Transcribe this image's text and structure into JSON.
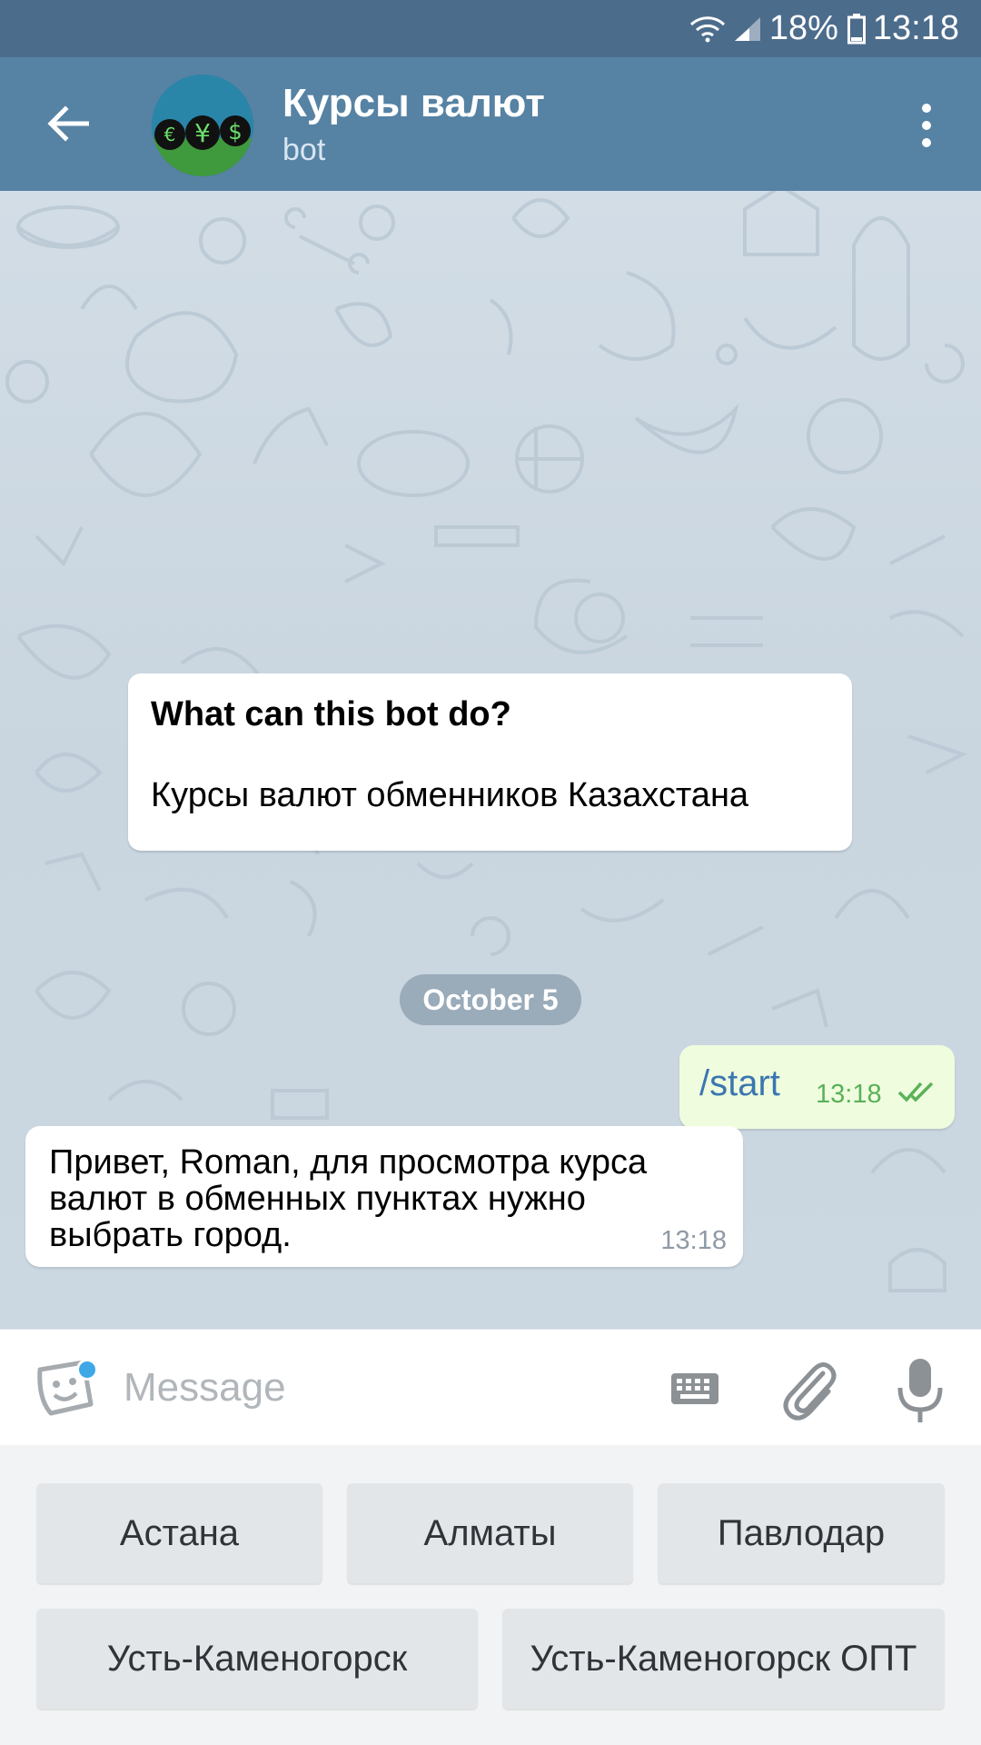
{
  "status_bar": {
    "battery": "18%",
    "time": "13:18"
  },
  "header": {
    "title": "Курсы валют",
    "subtitle": "bot"
  },
  "chat": {
    "bot_info": {
      "question": "What can this bot do?",
      "description": "Курсы валют обменников Казахстана"
    },
    "date_divider": "October 5",
    "messages": [
      {
        "direction": "out",
        "text": "/start",
        "time": "13:18",
        "status": "read"
      },
      {
        "direction": "in",
        "text": "Привет, Roman, для просмотра курса валют в обменных пунктах нужно выбрать город.",
        "time": "13:18"
      }
    ]
  },
  "input": {
    "placeholder": "Message"
  },
  "reply_keyboard": {
    "rows": [
      [
        "Астана",
        "Алматы",
        "Павлодар"
      ],
      [
        "Усть-Каменогорск",
        "Усть-Каменогорск ОПТ"
      ]
    ]
  },
  "colors": {
    "status_bar": "#4c6c8c",
    "header": "#5682a3",
    "outgoing_bubble": "#effdde",
    "read_ticks": "#5ab159",
    "link_text": "#3a77b0",
    "keyboard_bg": "#f2f3f4",
    "keyboard_button": "#e3e6e9"
  },
  "icons": {
    "back": "arrow-left-icon",
    "menu": "more-vertical-icon",
    "sticker": "sticker-smile-icon",
    "keyboard": "keyboard-icon",
    "attach": "paperclip-icon",
    "mic": "microphone-icon",
    "wifi": "wifi-icon",
    "signal": "signal-icon",
    "battery": "battery-icon"
  }
}
